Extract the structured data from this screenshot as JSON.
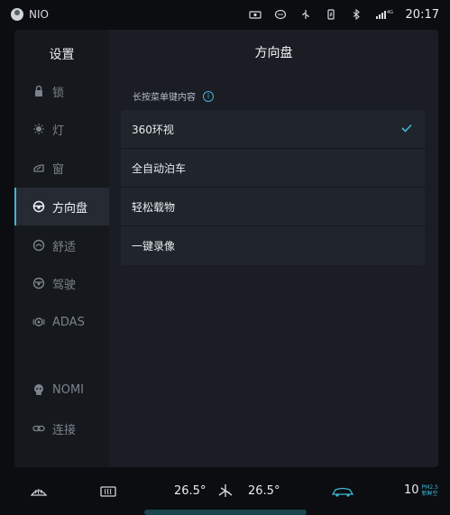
{
  "status_bar": {
    "carrier": "NIO",
    "network": "4G",
    "time": "20:17"
  },
  "sidebar": {
    "title": "设置",
    "items": [
      {
        "label": "锁",
        "icon": "lock-icon",
        "active": false
      },
      {
        "label": "灯",
        "icon": "light-icon",
        "active": false
      },
      {
        "label": "窗",
        "icon": "window-icon",
        "active": false
      },
      {
        "label": "方向盘",
        "icon": "steering-wheel-icon",
        "active": true
      },
      {
        "label": "舒适",
        "icon": "comfort-icon",
        "active": false
      },
      {
        "label": "驾驶",
        "icon": "driving-icon",
        "active": false
      },
      {
        "label": "ADAS",
        "icon": "adas-icon",
        "active": false
      },
      {
        "label": "NOMI",
        "icon": "nomi-icon",
        "active": false
      },
      {
        "label": "连接",
        "icon": "link-icon",
        "active": false
      }
    ]
  },
  "main": {
    "title": "方向盘",
    "section_label": "长按菜单键内容",
    "info_glyph": "i",
    "options": [
      {
        "label": "360环视",
        "selected": true
      },
      {
        "label": "全自动泊车",
        "selected": false
      },
      {
        "label": "轻松载物",
        "selected": false
      },
      {
        "label": "一键录像",
        "selected": false
      }
    ]
  },
  "climate": {
    "left_temp": "26.5°",
    "right_temp": "26.5°",
    "pm25_value": "10",
    "pm25_label": "PM2.5",
    "pm25_status": "新鲜空"
  },
  "colors": {
    "accent": "#3fb6d6",
    "panel": "#1a1e24",
    "sidebar": "#15181d"
  }
}
